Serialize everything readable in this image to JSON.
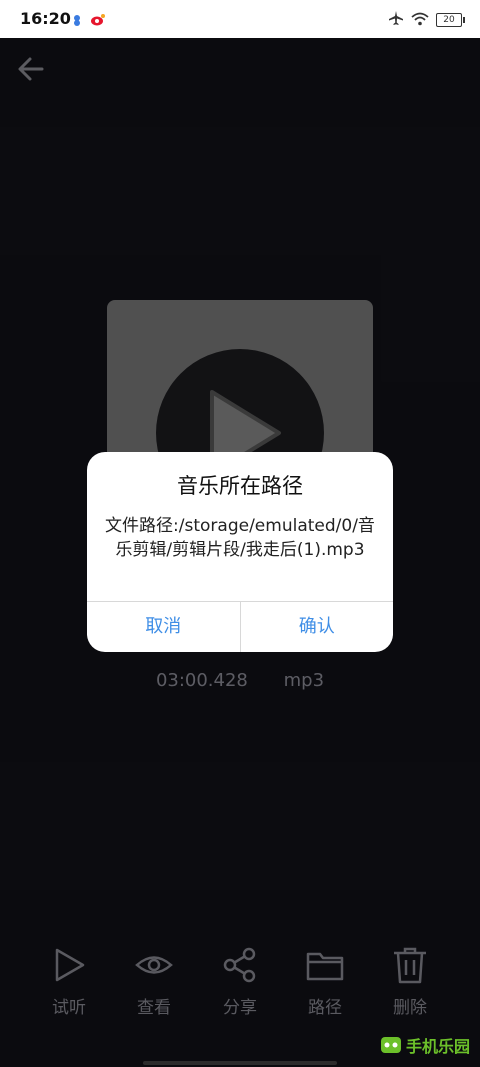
{
  "status": {
    "time": "16:20",
    "battery": "20"
  },
  "media": {
    "duration": "03:00.428",
    "format": "mp3"
  },
  "dialog": {
    "title": "音乐所在路径",
    "message": "文件路径:/storage/emulated/0/音乐剪辑/剪辑片段/我走后(1).mp3",
    "cancel": "取消",
    "confirm": "确认"
  },
  "toolbar": {
    "items": [
      {
        "label": "试听",
        "icon": "play-outline-icon"
      },
      {
        "label": "查看",
        "icon": "eye-icon"
      },
      {
        "label": "分享",
        "icon": "share-icon"
      },
      {
        "label": "路径",
        "icon": "folder-icon"
      },
      {
        "label": "删除",
        "icon": "trash-icon"
      }
    ]
  },
  "watermark": {
    "text": "手机乐园"
  },
  "colors": {
    "background": "#121218",
    "accent": "#3f8ee6",
    "toolbar_text": "#8a8a94"
  }
}
